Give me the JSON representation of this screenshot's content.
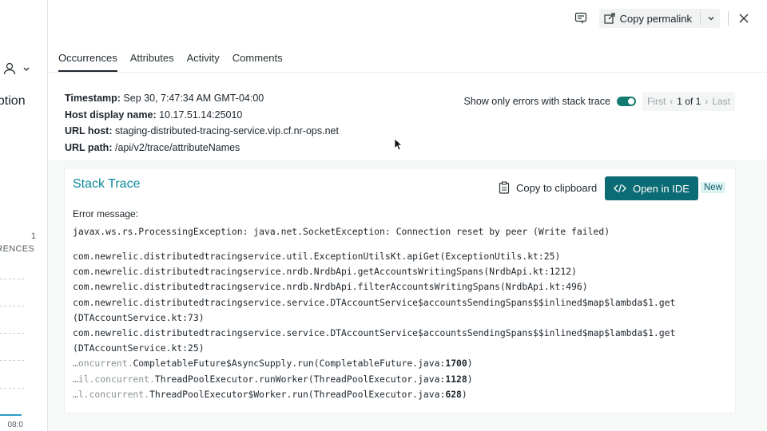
{
  "left_panel": {
    "title": "eption",
    "count": "1",
    "occurrences_label": "RENCES",
    "time": "08:0"
  },
  "topbar": {
    "copy_permalink_label": "Copy permalink"
  },
  "tabs": [
    {
      "label": "Occurrences",
      "active": true
    },
    {
      "label": "Attributes",
      "active": false
    },
    {
      "label": "Activity",
      "active": false
    },
    {
      "label": "Comments",
      "active": false
    }
  ],
  "meta": {
    "timestamp_label": "Timestamp:",
    "timestamp_value": "Sep 30, 7:47:34 AM GMT-04:00",
    "host_label": "Host display name:",
    "host_value": "10.17.51.14:25010",
    "url_host_label": "URL host:",
    "url_host_value": "staging-distributed-tracing-service.vip.cf.nr-ops.net",
    "url_path_label": "URL path:",
    "url_path_value": "/api/v2/trace/attributeNames"
  },
  "filter": {
    "toggle_label": "Show only errors with stack trace",
    "toggle_on": true,
    "pager_first": "First",
    "pager_current": "1 of 1",
    "pager_last": "Last"
  },
  "stack_trace": {
    "title": "Stack Trace",
    "copy_label": "Copy to clipboard",
    "open_ide_label": "Open in IDE",
    "new_badge": "New",
    "error_message_label": "Error message:",
    "error_message": "javax.ws.rs.ProcessingException: java.net.SocketException: Connection reset by peer (Write failed)",
    "frames": [
      {
        "dim": "",
        "main": "com.newrelic.distributedtracingservice.util.ExceptionUtilsKt.apiGet(ExceptionUtils.kt:25)",
        "line": "",
        "end": ""
      },
      {
        "dim": "",
        "main": "com.newrelic.distributedtracingservice.nrdb.NrdbApi.getAccountsWritingSpans(NrdbApi.kt:1212)",
        "line": "",
        "end": ""
      },
      {
        "dim": "",
        "main": "com.newrelic.distributedtracingservice.nrdb.NrdbApi.filterAccountsWritingSpans(NrdbApi.kt:496)",
        "line": "",
        "end": ""
      },
      {
        "dim": "",
        "main": "com.newrelic.distributedtracingservice.service.DTAccountService$accountsSendingSpans$$inlined$map$lambda$1.get",
        "line": "",
        "end": ""
      },
      {
        "dim": "",
        "main": "(DTAccountService.kt:73)",
        "line": "",
        "end": ""
      },
      {
        "dim": "",
        "main": "com.newrelic.distributedtracingservice.service.DTAccountService$accountsSendingSpans$$inlined$map$lambda$1.get",
        "line": "",
        "end": ""
      },
      {
        "dim": "",
        "main": "(DTAccountService.kt:25)",
        "line": "",
        "end": ""
      },
      {
        "dim": "…oncurrent.",
        "main": "CompletableFuture$AsyncSupply.run(CompletableFuture.java:",
        "line": "1700",
        "end": ")"
      },
      {
        "dim": "…il.concurrent.",
        "main": "ThreadPoolExecutor.runWorker(ThreadPoolExecutor.java:",
        "line": "1128",
        "end": ")"
      },
      {
        "dim": "…l.concurrent.",
        "main": "ThreadPoolExecutor$Worker.run(ThreadPoolExecutor.java:",
        "line": "628",
        "end": ")"
      }
    ]
  },
  "colors": {
    "accent": "#0c6c75",
    "title_teal": "#0c8a9c",
    "toggle_on": "#127a6f"
  }
}
